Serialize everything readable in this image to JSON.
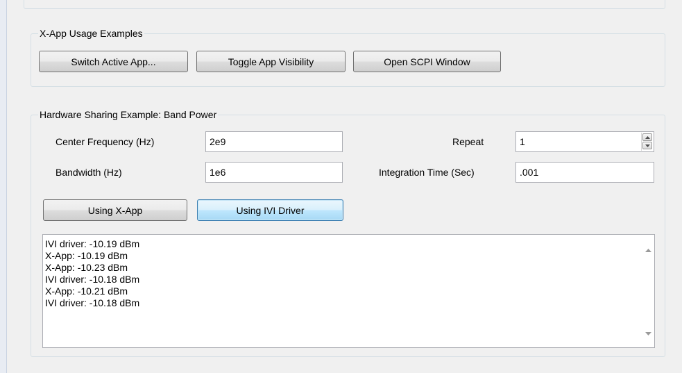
{
  "xapp_group": {
    "title": "X-App Usage Examples",
    "switch_label": "Switch Active App...",
    "toggle_label": "Toggle App Visibility",
    "scpi_label": "Open SCPI Window"
  },
  "hw_group": {
    "title": "Hardware Sharing Example: Band Power",
    "center_freq_label": "Center Frequency (Hz)",
    "center_freq_value": "2e9",
    "bandwidth_label": "Bandwidth (Hz)",
    "bandwidth_value": "1e6",
    "repeat_label": "Repeat",
    "repeat_value": "1",
    "integration_label": "Integration Time (Sec)",
    "integration_value": ".001",
    "using_xapp_label": "Using X-App",
    "using_ivi_label": "Using IVI Driver"
  },
  "output": {
    "lines": [
      "IVI driver: -10.19 dBm",
      "X-App: -10.19 dBm",
      "X-App: -10.23 dBm",
      "IVI driver: -10.18 dBm",
      "X-App: -10.21 dBm",
      "IVI driver: -10.18 dBm"
    ]
  },
  "icons": {
    "scroll_up": "scroll-up-arrow",
    "scroll_down": "scroll-down-arrow",
    "spin_up": "spin-up-arrow",
    "spin_down": "spin-down-arrow"
  }
}
